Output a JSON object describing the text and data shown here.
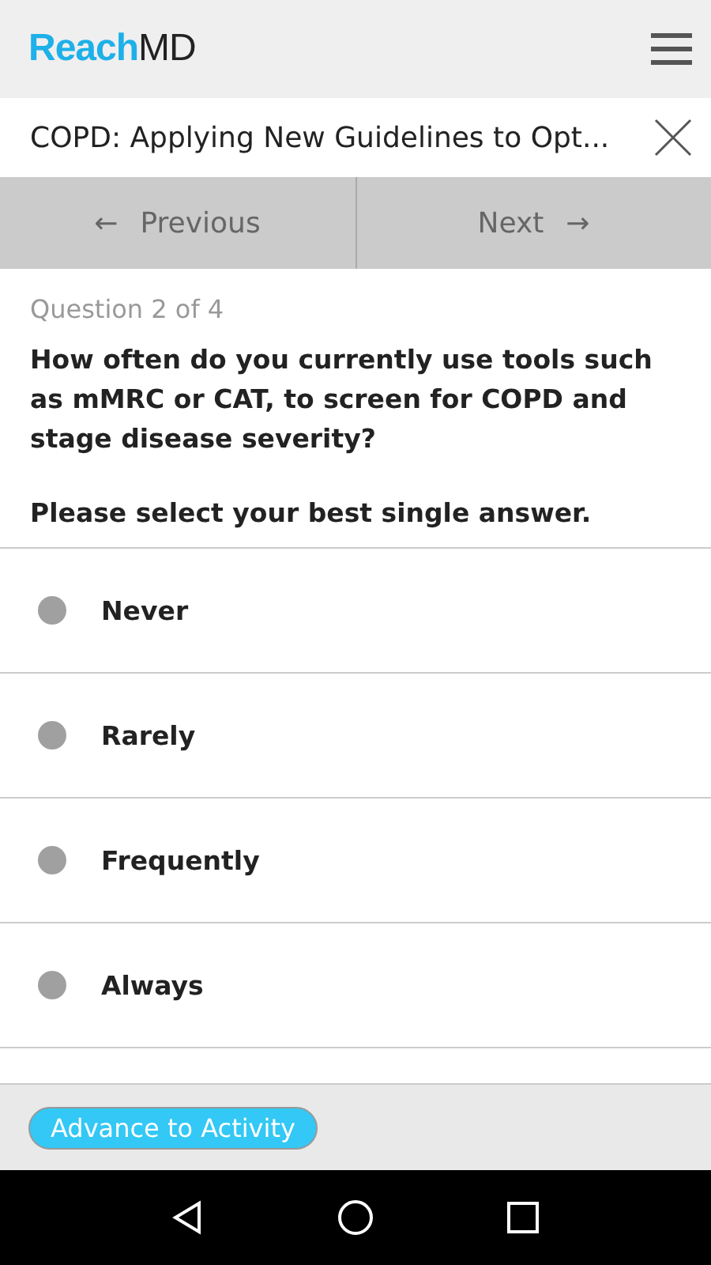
{
  "header": {
    "logo": [
      "Reach",
      "MD"
    ]
  },
  "activity": {
    "title": "COPD: Applying New Guidelines to Opt..."
  },
  "nav": {
    "previous": "Previous",
    "next": "Next",
    "previous_arrow": "←",
    "next_arrow": "→"
  },
  "question": {
    "counter": "Question 2 of 4",
    "text": "How often do you currently use tools such as mMRC or CAT, to screen for COPD and stage disease severity?",
    "instruction": "Please select your best single answer."
  },
  "options": [
    {
      "label": "Never",
      "selected": false
    },
    {
      "label": "Rarely",
      "selected": false
    },
    {
      "label": "Frequently",
      "selected": false
    },
    {
      "label": "Always",
      "selected": false
    }
  ],
  "footer": {
    "button": "Advance to Activity"
  }
}
